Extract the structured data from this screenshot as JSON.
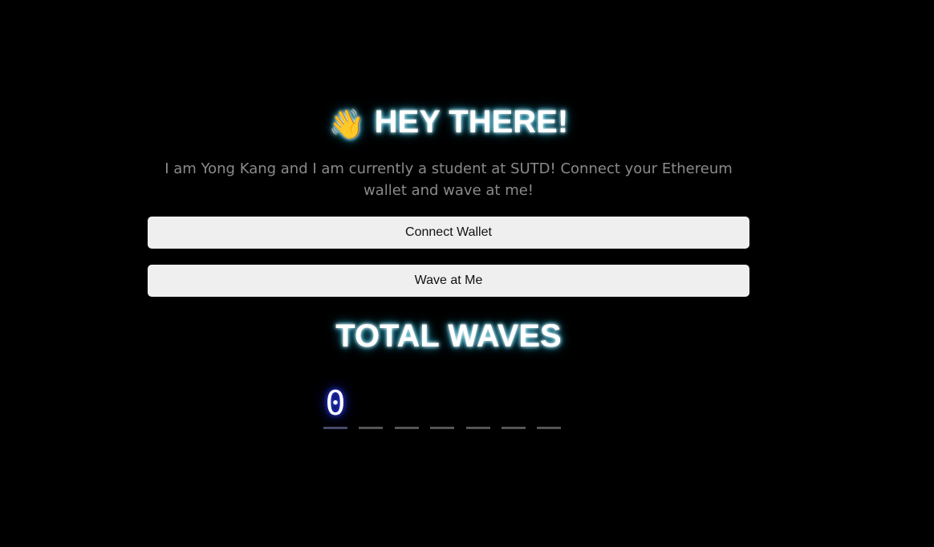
{
  "header": {
    "emoji": "👋",
    "title": "HEY THERE!"
  },
  "bio": {
    "text": "I am Yong Kang and I am currently a student at SUTD! Connect your Ethereum wallet and wave at me!"
  },
  "buttons": {
    "connect_label": "Connect Wallet",
    "wave_label": "Wave at Me"
  },
  "waves": {
    "title": "TOTAL WAVES",
    "digits": [
      "0",
      "",
      "",
      "",
      "",
      "",
      ""
    ]
  },
  "colors": {
    "background": "#000000",
    "glow_accent": "#2fb8d6",
    "digit_glow": "#3040ff",
    "button_bg": "#efefef",
    "bio_text": "#8a8a8a"
  }
}
